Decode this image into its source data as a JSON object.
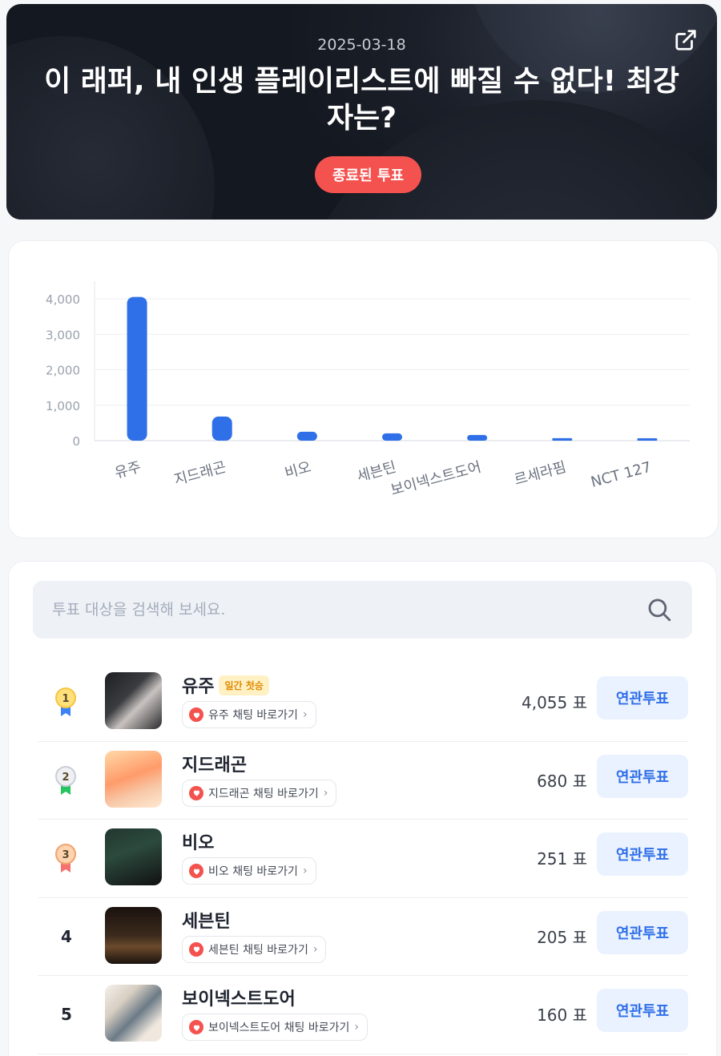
{
  "header": {
    "date": "2025-03-18",
    "title": "이 래퍼, 내 인생 플레이리스트에 빠질 수 없다! 최강자는?",
    "status_badge": "종료된 투표",
    "share_icon": "external-link-icon"
  },
  "colors": {
    "accent_red": "#f4524f",
    "bar_blue": "#2f6fe8",
    "button_bg": "#eaf2ff"
  },
  "chart_data": {
    "type": "bar",
    "categories": [
      "유주",
      "지드래곤",
      "비오",
      "세븐틴",
      "보이넥스트도어",
      "르세라핌",
      "NCT 127"
    ],
    "values": [
      4055,
      680,
      251,
      205,
      160,
      70,
      55
    ],
    "ylim": [
      0,
      4000
    ],
    "yticks": [
      0,
      1000,
      2000,
      3000,
      4000
    ],
    "ytick_labels": [
      "0",
      "1,000",
      "2,000",
      "3,000",
      "4,000"
    ],
    "grid": true
  },
  "search": {
    "placeholder": "투표 대상을 검색해 보세요.",
    "icon": "search-icon"
  },
  "list": {
    "vote_unit": "표",
    "button_label": "연관투표",
    "items": [
      {
        "rank": "1",
        "medal": "gold",
        "name": "유주",
        "tag": "일간 첫승",
        "chat": "유주 채팅 바로가기",
        "votes": "4,055 표",
        "button": "연관투표"
      },
      {
        "rank": "2",
        "medal": "silver",
        "name": "지드래곤",
        "tag": "",
        "chat": "지드래곤 채팅 바로가기",
        "votes": "680 표",
        "button": "연관투표"
      },
      {
        "rank": "3",
        "medal": "bronze",
        "name": "비오",
        "tag": "",
        "chat": "비오 채팅 바로가기",
        "votes": "251 표",
        "button": "연관투표"
      },
      {
        "rank": "4",
        "medal": "",
        "name": "세븐틴",
        "tag": "",
        "chat": "세븐틴 채팅 바로가기",
        "votes": "205 표",
        "button": "연관투표"
      },
      {
        "rank": "5",
        "medal": "",
        "name": "보이넥스트도어",
        "tag": "",
        "chat": "보이넥스트도어 채팅 바로가기",
        "votes": "160 표",
        "button": "연관투표"
      }
    ]
  }
}
